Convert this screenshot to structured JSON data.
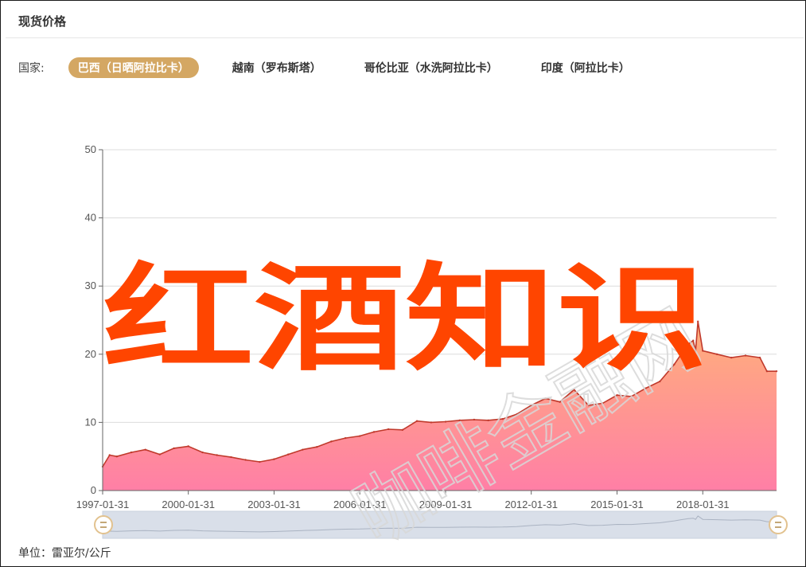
{
  "panel": {
    "title": "现货价格"
  },
  "country_filter": {
    "label": "国家:",
    "options": [
      {
        "label": "巴西（日晒阿拉比卡）",
        "active": true
      },
      {
        "label": "越南（罗布斯塔）",
        "active": false
      },
      {
        "label": "哥伦比亚（水洗阿拉比卡）",
        "active": false
      },
      {
        "label": "印度（阿拉比卡）",
        "active": false
      }
    ]
  },
  "colors": {
    "accent": "#d4a763",
    "line": "#c0392b",
    "fill_top": "#ffb07a",
    "fill_bottom": "#ff7fa6",
    "overlay_text": "#ff4500"
  },
  "overlay": {
    "text": "红酒知识",
    "watermark": "咖啡金融网"
  },
  "unit": "单位：雷亚尔/公斤",
  "chart_data": {
    "type": "area",
    "title": "",
    "xlabel": "",
    "ylabel": "",
    "ylim": [
      0,
      50
    ],
    "yticks": [
      0,
      10,
      20,
      30,
      40,
      50
    ],
    "xlim": [
      "1997-01-31",
      "2020-08-31"
    ],
    "xticks": [
      "1997-01-31",
      "2000-01-31",
      "2003-01-31",
      "2006-01-31",
      "2009-01-31",
      "2012-01-31",
      "2015-01-31",
      "2018-01-31"
    ],
    "grid": true,
    "series": [
      {
        "x": [
          "1997-01-31",
          "1997-04-30",
          "1997-07-31",
          "1998-01-31",
          "1998-07-31",
          "1999-01-31",
          "1999-07-31",
          "2000-01-31",
          "2000-07-31",
          "2001-01-31",
          "2001-07-31",
          "2002-01-31",
          "2002-07-31",
          "2003-01-31",
          "2003-07-31",
          "2004-01-31",
          "2004-07-31",
          "2005-01-31",
          "2005-07-31",
          "2006-01-31",
          "2006-07-31",
          "2007-01-31",
          "2007-07-31",
          "2008-01-31",
          "2008-07-31",
          "2009-01-31",
          "2009-07-31",
          "2010-01-31",
          "2010-07-31",
          "2011-01-31",
          "2011-07-31",
          "2012-01-31",
          "2012-07-31",
          "2013-01-31",
          "2013-07-31",
          "2014-01-31",
          "2014-07-31",
          "2015-01-31",
          "2015-07-31",
          "2016-01-31",
          "2016-07-31",
          "2017-01-31",
          "2017-04-30",
          "2017-07-31",
          "2017-09-30",
          "2017-10-31",
          "2017-11-30",
          "2018-01-31",
          "2018-07-31",
          "2019-01-31",
          "2019-07-31",
          "2020-01-31",
          "2020-04-30",
          "2020-08-31"
        ],
        "values": [
          3.5,
          5.2,
          5.0,
          5.6,
          6.0,
          5.3,
          6.2,
          6.5,
          5.6,
          5.2,
          4.9,
          4.5,
          4.2,
          4.6,
          5.3,
          6.0,
          6.4,
          7.2,
          7.7,
          8.0,
          8.6,
          9.0,
          8.9,
          10.2,
          10.0,
          10.1,
          10.3,
          10.4,
          10.3,
          10.5,
          11.2,
          12.5,
          13.5,
          13.0,
          14.8,
          12.5,
          12.8,
          14.0,
          13.8,
          15.0,
          16.0,
          18.5,
          20.0,
          21.5,
          22.0,
          20.5,
          24.8,
          20.5,
          20.0,
          19.5,
          19.8,
          19.5,
          17.5,
          17.5
        ]
      }
    ],
    "data_zoom": {
      "start": "1997-01-31",
      "end": "2020-08-31"
    }
  }
}
